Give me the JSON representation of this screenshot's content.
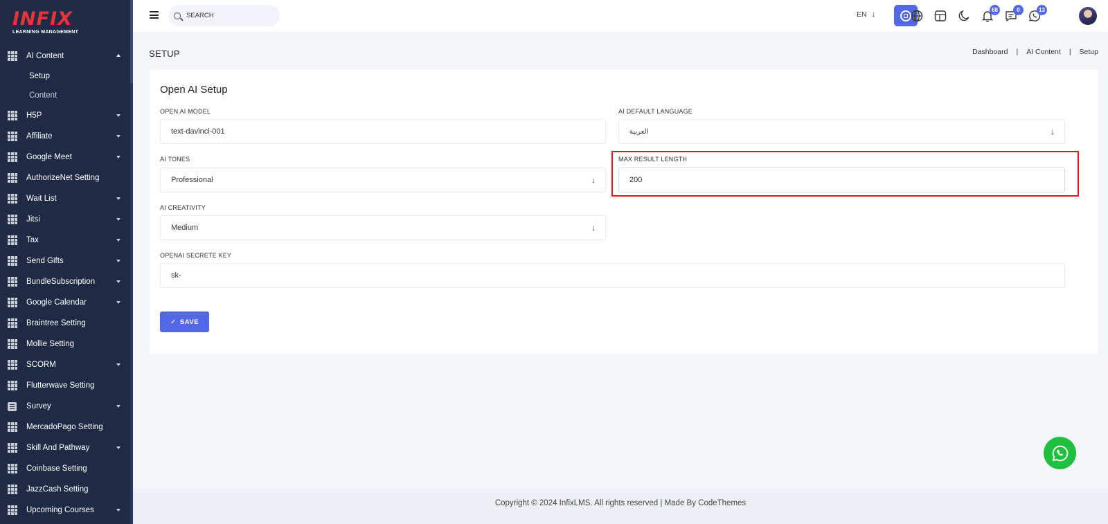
{
  "brand": {
    "logo": "INFIX",
    "tagline": "LEARNING MANAGEMENT"
  },
  "sidebar": {
    "items": [
      {
        "label": "AI Content",
        "expanded": true,
        "icon": "grid-icon"
      },
      {
        "label": "H5P",
        "caret": true,
        "icon": "grid-icon"
      },
      {
        "label": "Affiliate",
        "caret": true,
        "icon": "grid-icon"
      },
      {
        "label": "Google Meet",
        "caret": true,
        "icon": "grid-icon"
      },
      {
        "label": "AuthorizeNet Setting",
        "caret": false,
        "icon": "grid-icon"
      },
      {
        "label": "Wait List",
        "caret": true,
        "icon": "grid-icon"
      },
      {
        "label": "Jitsi",
        "caret": true,
        "icon": "grid-icon"
      },
      {
        "label": "Tax",
        "caret": true,
        "icon": "grid-icon"
      },
      {
        "label": "Send Gifts",
        "caret": true,
        "icon": "grid-icon"
      },
      {
        "label": "BundleSubscription",
        "caret": true,
        "icon": "grid-icon"
      },
      {
        "label": "Google Calendar",
        "caret": true,
        "icon": "grid-icon"
      },
      {
        "label": "Braintree Setting",
        "caret": false,
        "icon": "grid-icon"
      },
      {
        "label": "Mollie Setting",
        "caret": false,
        "icon": "grid-icon"
      },
      {
        "label": "SCORM",
        "caret": true,
        "icon": "grid-icon"
      },
      {
        "label": "Flutterwave Setting",
        "caret": false,
        "icon": "grid-icon"
      },
      {
        "label": "Survey",
        "caret": true,
        "icon": "survey-icon"
      },
      {
        "label": "MercadoPago Setting",
        "caret": false,
        "icon": "grid-icon"
      },
      {
        "label": "Skill And Pathway",
        "caret": true,
        "icon": "grid-icon"
      },
      {
        "label": "Coinbase Setting",
        "caret": false,
        "icon": "grid-icon"
      },
      {
        "label": "JazzCash Setting",
        "caret": false,
        "icon": "grid-icon"
      },
      {
        "label": "Upcoming Courses",
        "caret": true,
        "icon": "grid-icon"
      }
    ],
    "subitems": [
      {
        "label": "Setup",
        "active": true
      },
      {
        "label": "Content",
        "active": false
      }
    ]
  },
  "header": {
    "search_placeholder": "SEARCH",
    "language": "EN",
    "notifications_count": "68",
    "messages_count": "0",
    "whatsapp_count": "13"
  },
  "page": {
    "title": "SETUP",
    "breadcrumb": [
      "Dashboard",
      "AI Content",
      "Setup"
    ]
  },
  "form": {
    "card_title": "Open AI Setup",
    "open_ai_model_label": "OPEN AI MODEL",
    "open_ai_model_value": "text-davinci-001",
    "default_language_label": "AI DEFAULT LANGUAGE",
    "default_language_value": "العربية",
    "tones_label": "AI TONES",
    "tones_value": "Professional",
    "max_result_label": "MAX RESULT LENGTH",
    "max_result_value": "200",
    "creativity_label": "AI CREATIVITY",
    "creativity_value": "Medium",
    "secret_key_label": "OPENAI SECRETE KEY",
    "secret_key_value": "sk-",
    "save_label": "SAVE"
  },
  "footer": {
    "text": "Copyright © 2024 InfixLMS. All rights reserved | Made By CodeThemes"
  },
  "colors": {
    "accent": "#5468e7",
    "sidebar": "#1f2a44",
    "highlight": "#e8141e",
    "whatsapp": "#1fbf3f"
  }
}
